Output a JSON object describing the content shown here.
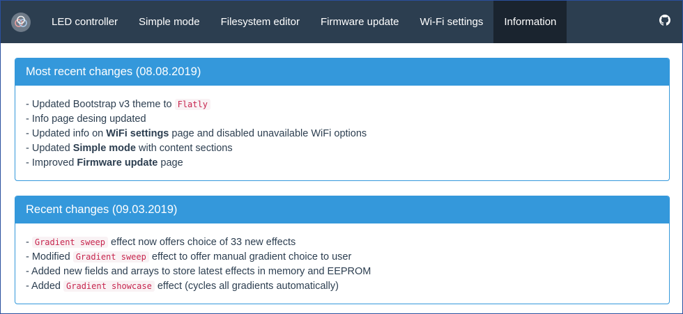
{
  "nav": {
    "items": [
      {
        "label": "LED controller"
      },
      {
        "label": "Simple mode"
      },
      {
        "label": "Filesystem editor"
      },
      {
        "label": "Firmware update"
      },
      {
        "label": "Wi-Fi settings"
      },
      {
        "label": "Information",
        "active": true
      }
    ],
    "logo_icon": "app-logo-icon",
    "github_icon": "github-icon"
  },
  "panels": [
    {
      "title": "Most recent changes (08.08.2019)",
      "lines": [
        {
          "pre": "- Updated Bootstrap v3 theme to ",
          "code": "Flatly",
          "post": ""
        },
        {
          "pre": "- Info page desing updated",
          "bold": "",
          "post": ""
        },
        {
          "pre": "- Updated info on ",
          "bold": "WiFi settings",
          "post": " page and disabled unavailable WiFi options"
        },
        {
          "pre": "- Updated ",
          "bold": "Simple mode",
          "post": " with content sections"
        },
        {
          "pre": "- Improved ",
          "bold": "Firmware update",
          "post": " page"
        }
      ]
    },
    {
      "title": "Recent changes (09.03.2019)",
      "lines": [
        {
          "pre": "- ",
          "code": "Gradient sweep",
          "post": " effect now offers choice of 33 new effects"
        },
        {
          "pre": "- Modified ",
          "code": "Gradient sweep",
          "post": " effect to offer manual gradient choice to user"
        },
        {
          "pre": "- Added new fields and arrays to store latest effects in memory and EEPROM",
          "bold": "",
          "post": ""
        },
        {
          "pre": "- Added ",
          "code": "Gradient showcase",
          "post": " effect (cycles all gradients automatically)"
        }
      ]
    }
  ],
  "colors": {
    "navbar": "#2c3e50",
    "nav_active": "#1a242f",
    "panel_primary": "#3498db",
    "code_text": "#c7254e",
    "code_bg": "#f9f2f4"
  }
}
